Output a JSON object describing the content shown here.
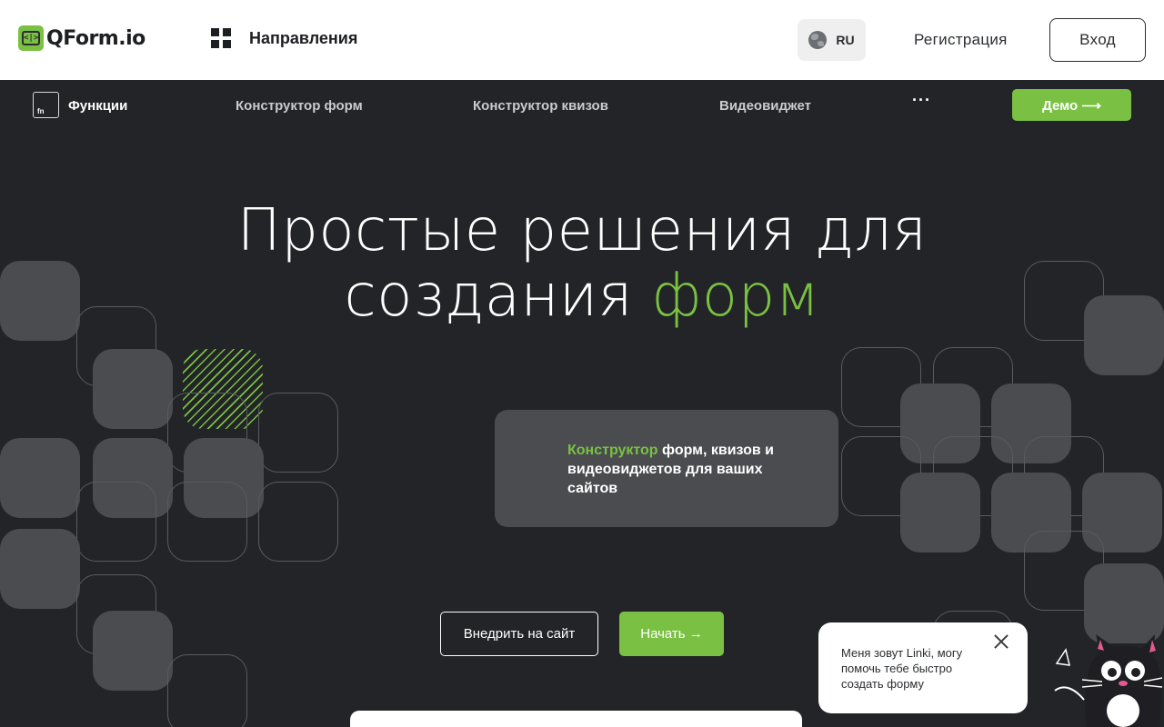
{
  "header": {
    "logo_glyph": "<|>",
    "logo_text": "QForm.io",
    "directions_label": "Направления",
    "lang_label": "RU",
    "register_label": "Регистрация",
    "login_label": "Вход"
  },
  "subnav": {
    "fn_badge": "fn",
    "items": [
      {
        "label": "Функции"
      },
      {
        "label": "Конструктор форм"
      },
      {
        "label": "Конструктор квизов"
      },
      {
        "label": "Видеовиджет"
      }
    ],
    "more_label": "···",
    "demo_label": "Демо ⟶"
  },
  "hero": {
    "title_line1": "Простые решения для",
    "title_line2_part1": "создания ",
    "title_line2_accent": "форм",
    "card_accent": "Конструктор",
    "card_text": " форм, квизов и видеовиджетов для ваших сайтов",
    "embed_label": "Внедрить на сайт",
    "start_label": "Начать →"
  },
  "chat": {
    "message": "Меня зовут Linki, могу помочь тебе быстро создать форму"
  },
  "colors": {
    "accent": "#7ac143",
    "background": "#222427",
    "tile": "#4a4c50"
  }
}
